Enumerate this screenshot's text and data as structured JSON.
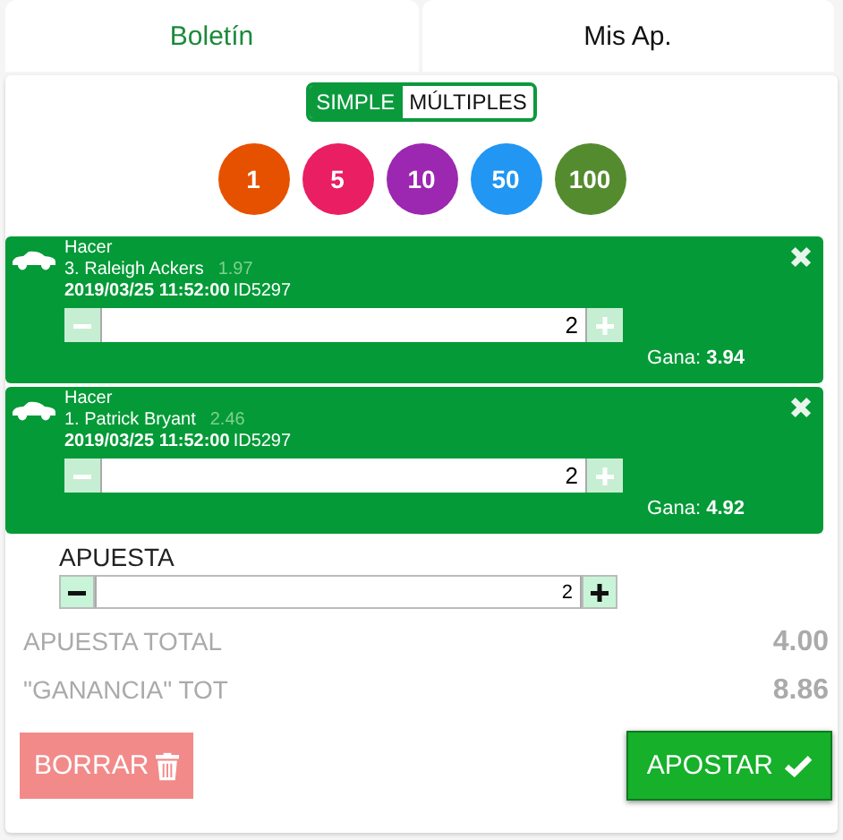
{
  "tabs": [
    {
      "label": "Boletín",
      "selected": true
    },
    {
      "label": "Mis Ap.",
      "selected": false
    }
  ],
  "modes": [
    {
      "label": "SIMPLE",
      "selected": true
    },
    {
      "label": "MÚLTIPLES",
      "selected": false
    }
  ],
  "chips": [
    {
      "label": "1",
      "color": "#e65100"
    },
    {
      "label": "5",
      "color": "#e91e63"
    },
    {
      "label": "10",
      "color": "#9c27b0"
    },
    {
      "label": "50",
      "color": "#2196f3"
    },
    {
      "label": "100",
      "color": "#558b2f"
    }
  ],
  "bets": [
    {
      "type": "Hacer",
      "runner": "3. Raleigh Ackers",
      "odds": "1.97",
      "datetime": "2019/03/25 11:52:00",
      "event_id": "ID5297",
      "stake": "2",
      "win_label": "Gana:",
      "win": "3.94"
    },
    {
      "type": "Hacer",
      "runner": "1. Patrick Bryant",
      "odds": "2.46",
      "datetime": "2019/03/25 11:52:00",
      "event_id": "ID5297",
      "stake": "2",
      "win_label": "Gana:",
      "win": "4.92"
    }
  ],
  "stake": {
    "label": "APUESTA",
    "value": "2"
  },
  "totals": [
    {
      "label": "APUESTA TOTAL",
      "value": "4.00"
    },
    {
      "label": "\"GANANCIA\" TOT",
      "value": "8.86"
    }
  ],
  "buttons": {
    "clear": "BORRAR",
    "place": "APOSTAR"
  }
}
